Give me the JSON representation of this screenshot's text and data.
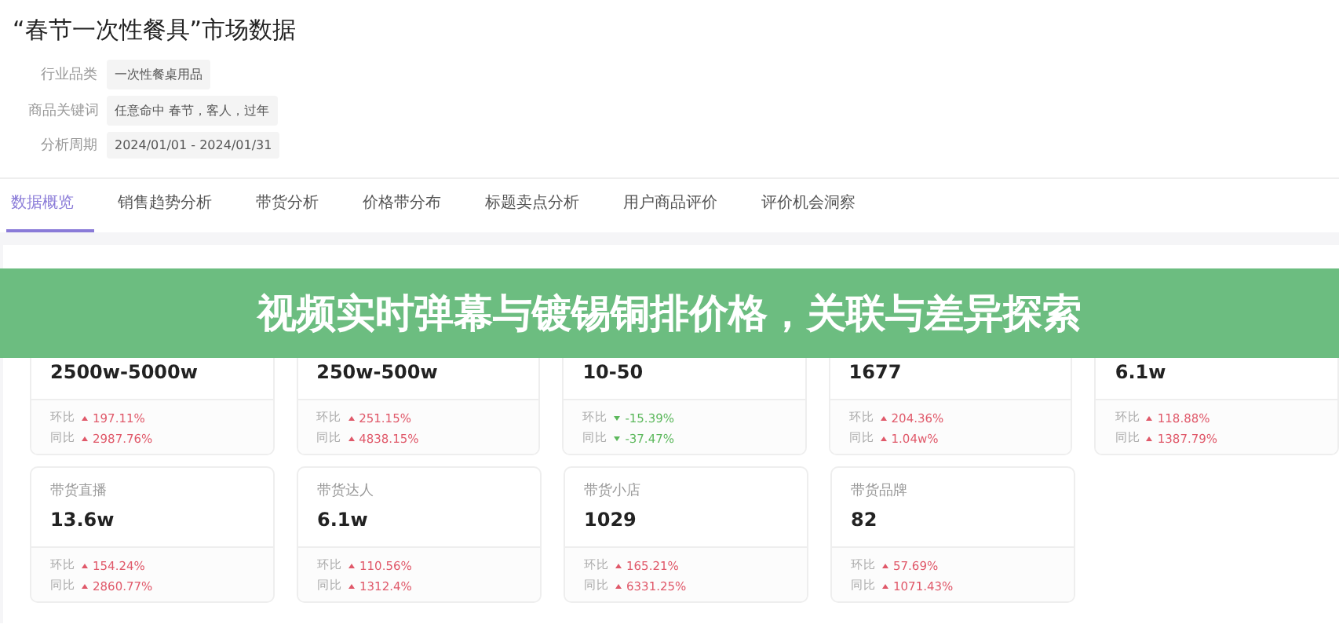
{
  "page_title": "“春节一次性餐具”市场数据",
  "filters": [
    {
      "label": "行业品类",
      "value": "一次性餐桌用品"
    },
    {
      "label": "商品关键词",
      "value": "任意命中 春节，客人，过年"
    },
    {
      "label": "分析周期",
      "value": "2024/01/01 - 2024/01/31"
    }
  ],
  "tabs": [
    {
      "label": "数据概览",
      "selected": true
    },
    {
      "label": "销售趋势分析",
      "selected": false
    },
    {
      "label": "带货分析",
      "selected": false
    },
    {
      "label": "价格带分布",
      "selected": false
    },
    {
      "label": "标题卖点分析",
      "selected": false
    },
    {
      "label": "用户商品评价",
      "selected": false
    },
    {
      "label": "评价机会洞察",
      "selected": false
    }
  ],
  "card_rows": [
    [
      {
        "value": "2500w-5000w",
        "changes": [
          {
            "label": "环比",
            "rising": true,
            "value": "197.11%"
          },
          {
            "label": "同比",
            "rising": true,
            "value": "2987.76%"
          }
        ]
      },
      {
        "value": "250w-500w",
        "changes": [
          {
            "label": "环比",
            "rising": true,
            "value": "251.15%"
          },
          {
            "label": "同比",
            "rising": true,
            "value": "4838.15%"
          }
        ]
      },
      {
        "value": "10-50",
        "changes": [
          {
            "label": "环比",
            "rising": false,
            "value": "-15.39%"
          },
          {
            "label": "同比",
            "rising": false,
            "value": "-37.47%"
          }
        ]
      },
      {
        "value": "1677",
        "changes": [
          {
            "label": "环比",
            "rising": true,
            "value": "204.36%"
          },
          {
            "label": "同比",
            "rising": true,
            "value": "1.04w%"
          }
        ]
      },
      {
        "value": "6.1w",
        "changes": [
          {
            "label": "环比",
            "rising": true,
            "value": "118.88%"
          },
          {
            "label": "同比",
            "rising": true,
            "value": "1387.79%"
          }
        ]
      }
    ],
    [
      {
        "label": "带货直播",
        "value": "13.6w",
        "changes": [
          {
            "label": "环比",
            "rising": true,
            "value": "154.24%"
          },
          {
            "label": "同比",
            "rising": true,
            "value": "2860.77%"
          }
        ]
      },
      {
        "label": "带货达人",
        "value": "6.1w",
        "changes": [
          {
            "label": "环比",
            "rising": true,
            "value": "110.56%"
          },
          {
            "label": "同比",
            "rising": true,
            "value": "1312.4%"
          }
        ]
      },
      {
        "label": "带货小店",
        "value": "1029",
        "changes": [
          {
            "label": "环比",
            "rising": true,
            "value": "165.21%"
          },
          {
            "label": "同比",
            "rising": true,
            "value": "6331.25%"
          }
        ]
      },
      {
        "label": "带货品牌",
        "value": "82",
        "changes": [
          {
            "label": "环比",
            "rising": true,
            "value": "57.69%"
          },
          {
            "label": "同比",
            "rising": true,
            "value": "1071.43%"
          }
        ]
      }
    ]
  ],
  "banner": {
    "title": "视频实时弹幕与镀锡铜排价格，关联与差异探索"
  }
}
